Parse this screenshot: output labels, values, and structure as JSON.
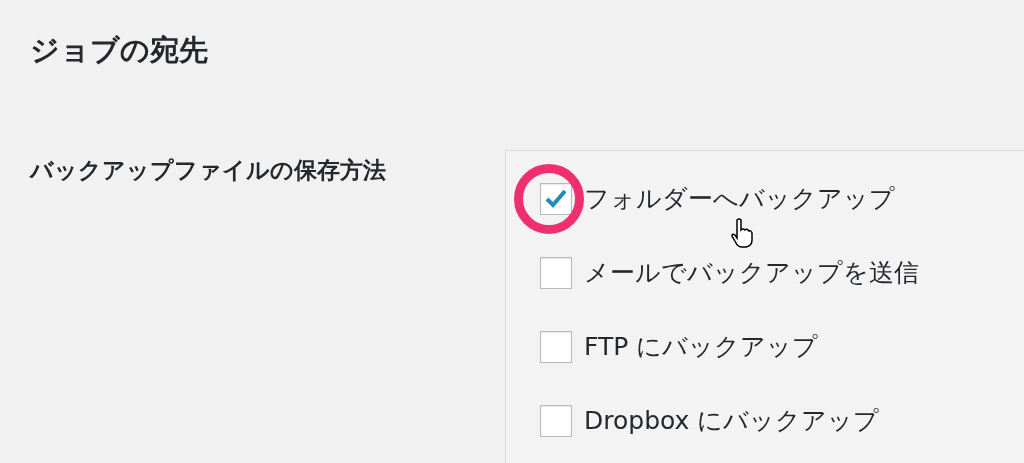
{
  "section_title": "ジョブの宛先",
  "field_label": "バックアップファイルの保存方法",
  "options": [
    {
      "label": "フォルダーへバックアップ",
      "checked": true
    },
    {
      "label": "メールでバックアップを送信",
      "checked": false
    },
    {
      "label": "FTP にバックアップ",
      "checked": false
    },
    {
      "label": "Dropbox にバックアップ",
      "checked": false
    }
  ]
}
